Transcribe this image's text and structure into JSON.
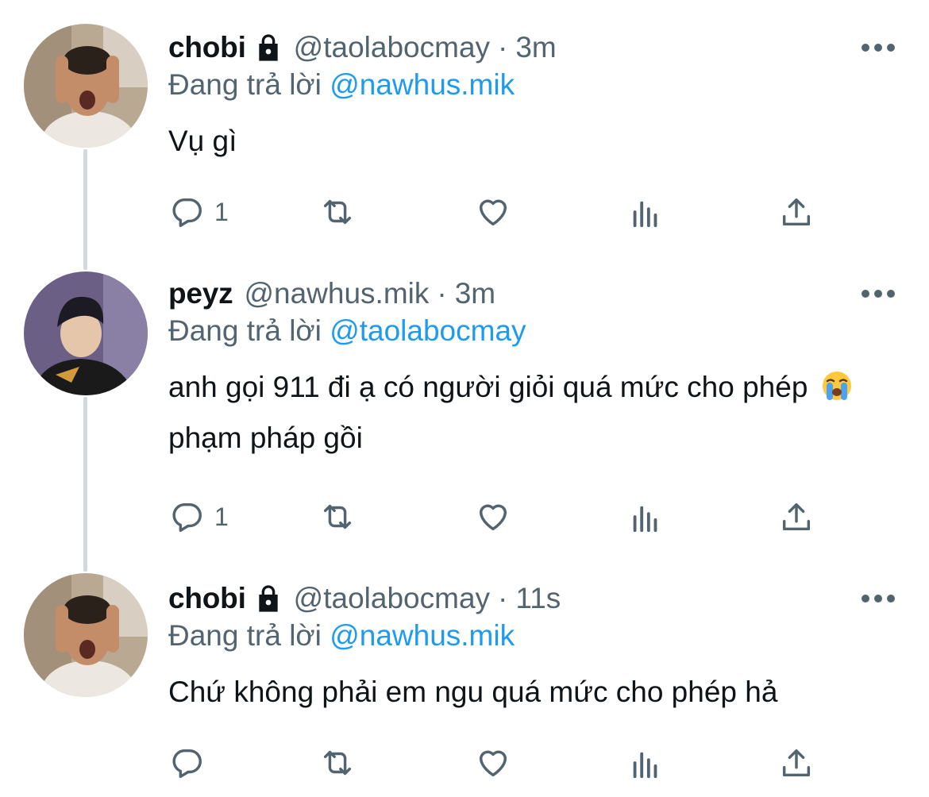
{
  "thread": {
    "tweets": [
      {
        "display_name": "chobi",
        "protected": true,
        "handle": "@taolabocmay",
        "separator": "·",
        "time": "3m",
        "replying_label": "Đang trả lời",
        "replying_to": "@nawhus.mik",
        "text": "Vụ gì",
        "reply_count": "1",
        "avatar": "person-screaming-hands-on-head"
      },
      {
        "display_name": "peyz",
        "protected": false,
        "handle": "@nawhus.mik",
        "separator": "·",
        "time": "3m",
        "replying_label": "Đang trả lời",
        "replying_to": "@taolabocmay",
        "text_part1": "anh gọi 911 đi ạ có người giỏi quá mức cho phép",
        "emoji": "loudly-crying-face",
        "text_part2": "phạm pháp gồi",
        "reply_count": "1",
        "avatar": "young-man-esports-jersey"
      },
      {
        "display_name": "chobi",
        "protected": true,
        "handle": "@taolabocmay",
        "separator": "·",
        "time": "11s",
        "replying_label": "Đang trả lời",
        "replying_to": "@nawhus.mik",
        "text": "Chứ không phải em ngu quá mức cho phép hả",
        "reply_count": "",
        "avatar": "person-screaming-hands-on-head"
      }
    ]
  },
  "icons": {
    "lock": "lock-icon",
    "more": "more-icon",
    "reply": "reply-icon",
    "retweet": "retweet-icon",
    "like": "like-icon",
    "views": "views-icon",
    "share": "share-icon"
  },
  "colors": {
    "link": "#1d9bf0",
    "secondary_text": "#536471",
    "primary_text": "#0f1419",
    "thread_line": "#cfd9de"
  }
}
